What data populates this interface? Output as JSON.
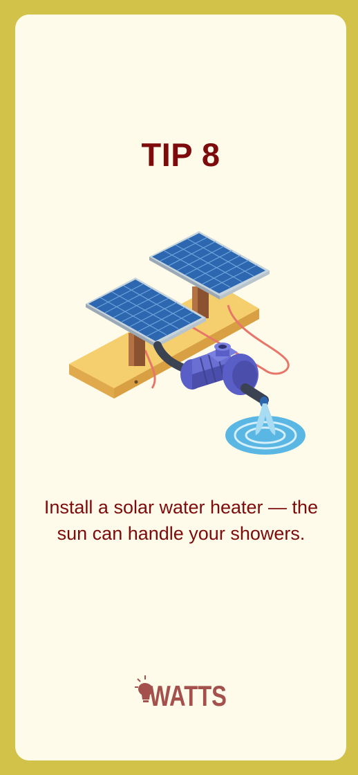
{
  "tip": {
    "title": "TIP 8",
    "text": "Install a solar water heater — the sun can handle your showers."
  },
  "brand": {
    "name": "WATTS"
  },
  "icons": {
    "illustration": "solar-panels-pump-icon",
    "logo": "lightbulb-icon"
  },
  "colors": {
    "frame": "#d3c24a",
    "card": "#fefbea",
    "accent": "#7d0b0b",
    "logo": "#a4514e"
  }
}
